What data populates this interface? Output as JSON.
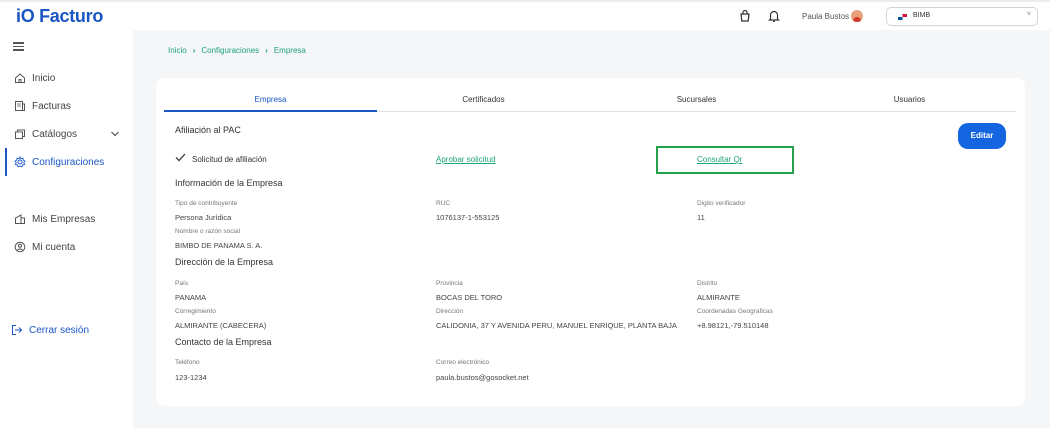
{
  "app": {
    "logo": "iO Facturo"
  },
  "topbar": {
    "user_name": "Paula Bustos",
    "company": "BIMB",
    "company_caret": "˅"
  },
  "sidebar": {
    "items": [
      {
        "label": "Inicio",
        "icon": "home-icon"
      },
      {
        "label": "Facturas",
        "icon": "invoice-icon"
      },
      {
        "label": "Catálogos",
        "icon": "catalog-icon"
      },
      {
        "label": "Configuraciones",
        "icon": "gear-icon"
      },
      {
        "label": "Mis Empresas",
        "icon": "building-icon"
      },
      {
        "label": "Mi cuenta",
        "icon": "user-circle-icon"
      }
    ],
    "logout": "Cerrar sesión"
  },
  "breadcrumb": [
    "Inicio",
    "Configuraciones",
    "Empresa"
  ],
  "tabs": [
    "Empresa",
    "Certificados",
    "Sucursales",
    "Usuarios"
  ],
  "pac": {
    "title": "Afiliación al PAC",
    "status": "Solicitud de afiliación",
    "approve": "Aprobar solicitud",
    "qr": "Consultar Qr",
    "edit": "Editar"
  },
  "empresa": {
    "title": "Información de la Empresa",
    "tipo_label": "Tipo de contribuyente",
    "tipo_value": "Persona Jurídica",
    "ruc_label": "RUC",
    "ruc_value": "1076137-1-553125",
    "dv_label": "Digito verificador",
    "dv_value": "11",
    "razon_label": "Nombre o razón social",
    "razon_value": "BIMBO DE PANAMA S. A."
  },
  "direccion": {
    "title": "Dirección de la Empresa",
    "pais_label": "País",
    "pais_value": "PANAMA",
    "provincia_label": "Provincia",
    "provincia_value": "BOCAS DEL TORO",
    "distrito_label": "Distrito",
    "distrito_value": "ALMIRANTE",
    "corr_label": "Corregimiento",
    "corr_value": "ALMIRANTE (CABECERA)",
    "dir_label": "Dirección",
    "dir_value": "CALIDONIA, 37 Y AVENIDA PERU, MANUEL ENRIQUE, PLANTA BAJA",
    "coord_label": "Coordenadas Geograficas",
    "coord_value": "+8.98121,-79.510148"
  },
  "contacto": {
    "title": "Contacto de la Empresa",
    "tel_label": "Teléfono",
    "tel_value": "123-1234",
    "email_label": "Correo electrónico",
    "email_value": "paula.bustos@gosocket.net"
  },
  "colors": {
    "primary": "#1a56c4",
    "accent_green": "#1fa37a",
    "button": "#1565e0",
    "highlight": "#23a14a"
  }
}
